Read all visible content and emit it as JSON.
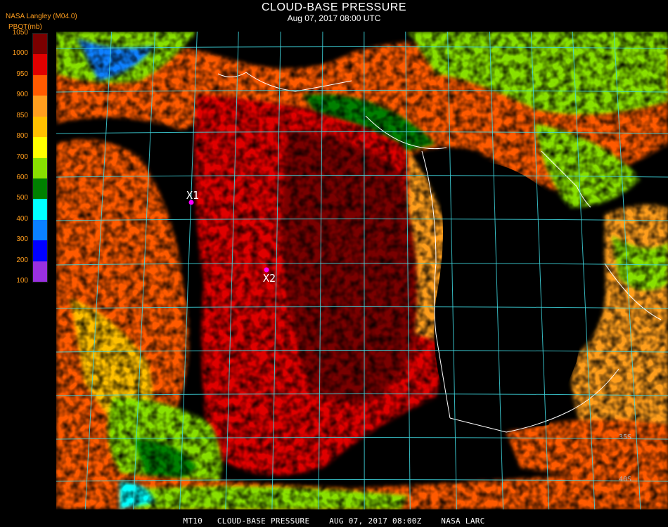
{
  "header": {
    "title": "CLOUD-BASE PRESSURE",
    "subtitle": "Aug 07, 2017 08:00 UTC",
    "producer": "NASA Langley (M04.0)",
    "parameter": "PBOT(mb)"
  },
  "legend": {
    "ticks": [
      "1050",
      "1000",
      "950",
      "900",
      "850",
      "800",
      "700",
      "600",
      "500",
      "400",
      "300",
      "200",
      "100"
    ],
    "colors": [
      "#7a0000",
      "#e00000",
      "#ff5a00",
      "#ff9e1e",
      "#ffc000",
      "#ffff00",
      "#88e000",
      "#008000",
      "#00ffff",
      "#0a80ff",
      "#0000ff",
      "#9930e0"
    ]
  },
  "map": {
    "markers": [
      {
        "label": "X1",
        "color": "#ff00ff"
      },
      {
        "label": "X2",
        "color": "#ff00ff"
      }
    ],
    "lat_labels": [
      "35S",
      "40S"
    ],
    "grid_color": "#40d8e0",
    "coast_color": "#ffffff"
  },
  "footer": {
    "text": "MT10   CLOUD-BASE PRESSURE    AUG 07, 2017 08:00Z    NASA LARC"
  }
}
